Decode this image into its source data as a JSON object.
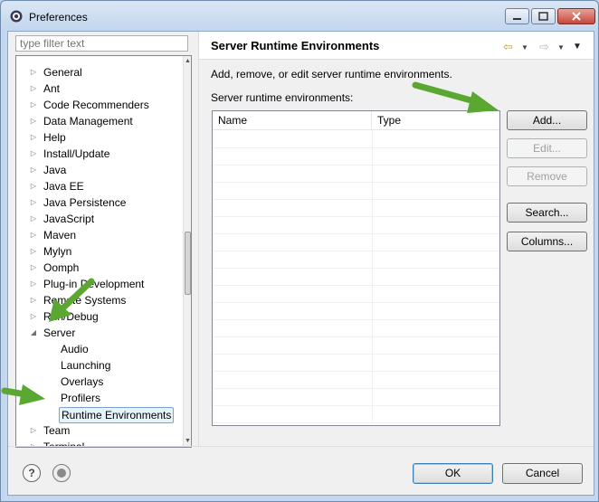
{
  "window": {
    "title": "Preferences"
  },
  "filter": {
    "placeholder": "type filter text"
  },
  "tree": {
    "items": [
      {
        "label": "General",
        "expandable": true
      },
      {
        "label": "Ant",
        "expandable": true
      },
      {
        "label": "Code Recommenders",
        "expandable": true
      },
      {
        "label": "Data Management",
        "expandable": true
      },
      {
        "label": "Help",
        "expandable": true
      },
      {
        "label": "Install/Update",
        "expandable": true
      },
      {
        "label": "Java",
        "expandable": true
      },
      {
        "label": "Java EE",
        "expandable": true
      },
      {
        "label": "Java Persistence",
        "expandable": true
      },
      {
        "label": "JavaScript",
        "expandable": true
      },
      {
        "label": "Maven",
        "expandable": true
      },
      {
        "label": "Mylyn",
        "expandable": true
      },
      {
        "label": "Oomph",
        "expandable": true
      },
      {
        "label": "Plug-in Development",
        "expandable": true
      },
      {
        "label": "Remote Systems",
        "expandable": true
      },
      {
        "label": "Run/Debug",
        "expandable": true
      },
      {
        "label": "Server",
        "expanded": true
      },
      {
        "label": "Audio",
        "child": true
      },
      {
        "label": "Launching",
        "child": true
      },
      {
        "label": "Overlays",
        "child": true
      },
      {
        "label": "Profilers",
        "child": true
      },
      {
        "label": "Runtime Environments",
        "child": true,
        "selected": true
      },
      {
        "label": "Team",
        "expandable": true
      },
      {
        "label": "Terminal",
        "expandable": true
      }
    ]
  },
  "page": {
    "title": "Server Runtime Environments",
    "description": "Add, remove, or edit server runtime environments.",
    "table_label": "Server runtime environments:",
    "columns": [
      "Name",
      "Type"
    ],
    "row_count": 17
  },
  "buttons": {
    "add": "Add...",
    "edit": "Edit...",
    "remove": "Remove",
    "search": "Search...",
    "columns": "Columns..."
  },
  "footer": {
    "help": "?",
    "ok": "OK",
    "cancel": "Cancel"
  },
  "colors": {
    "arrow": "#5aa832",
    "selection": "#e5f3fb"
  }
}
